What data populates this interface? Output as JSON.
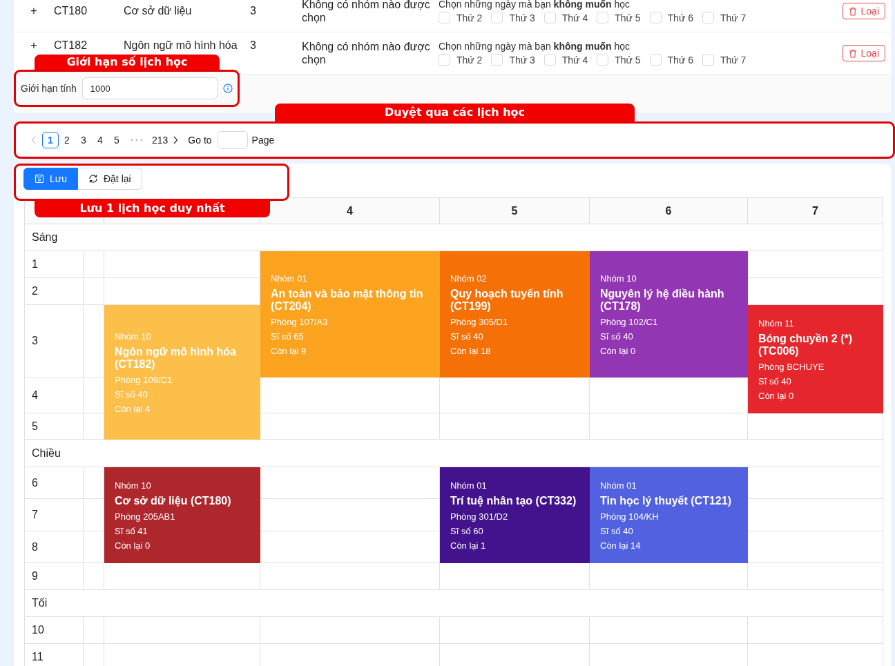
{
  "course_rows": [
    {
      "expand": "+",
      "code": "CT180",
      "name": "Cơ sở dữ liệu",
      "credits": "3",
      "status": "Không có nhóm nào được chọn",
      "prompt": "Chọn những ngày mà bạn **không muốn** học",
      "days": [
        {
          "label": "Thứ 2",
          "checked": false
        },
        {
          "label": "Thứ 3",
          "checked": false
        },
        {
          "label": "Thứ 4",
          "checked": false
        },
        {
          "label": "Thứ 5",
          "checked": false
        },
        {
          "label": "Thứ 6",
          "checked": false
        },
        {
          "label": "Thứ 7",
          "checked": false
        }
      ],
      "remove": "Loại"
    },
    {
      "expand": "+",
      "code": "CT182",
      "name": "Ngôn ngữ mô hình hóa",
      "credits": "3",
      "status": "Không có nhóm nào được chọn",
      "prompt": "Chọn những ngày mà bạn **không muốn** học",
      "days": [
        {
          "label": "Thứ 2",
          "checked": false
        },
        {
          "label": "Thứ 3",
          "checked": false
        },
        {
          "label": "Thứ 4",
          "checked": false
        },
        {
          "label": "Thứ 5",
          "checked": false
        },
        {
          "label": "Thứ 6",
          "checked": false
        },
        {
          "label": "Thứ 7",
          "checked": false
        }
      ],
      "remove": "Loại"
    }
  ],
  "limit": {
    "annotation": "Giới hạn số lịch học",
    "label": "Giới hạn tính",
    "value": "1000"
  },
  "pagination": {
    "annotation": "Duyệt qua các lịch học",
    "prev_disabled": true,
    "next_disabled": false,
    "pages": [
      {
        "kind": "page",
        "label": "1",
        "selected": true
      },
      {
        "kind": "page",
        "label": "2",
        "selected": false
      },
      {
        "kind": "page",
        "label": "3",
        "selected": false
      },
      {
        "kind": "page",
        "label": "4",
        "selected": false
      },
      {
        "kind": "page",
        "label": "5",
        "selected": false
      },
      {
        "kind": "ellipsis"
      },
      {
        "kind": "page",
        "label": "213",
        "selected": false
      }
    ],
    "goto_label": "Go to",
    "page_label": "Page"
  },
  "actions": {
    "annotation": "Lưu 1 lịch học duy nhất",
    "buttons": [
      {
        "label": "Lưu",
        "kind": "primary"
      },
      {
        "label": "Đặt lại",
        "kind": "default"
      }
    ]
  },
  "timetable": {
    "days": [
      {
        "label": "4"
      },
      {
        "label": "5"
      },
      {
        "label": "6"
      },
      {
        "label": "7"
      }
    ],
    "rows": [
      {
        "kind": "section",
        "label": "Sáng"
      },
      {
        "kind": "period",
        "label": "1",
        "cells": [
          {
            "kind": "empty"
          },
          {
            "kind": "empty"
          },
          {
            "kind": "class",
            "group": "Nhóm 01",
            "title": "An toàn và bảo mật thông tin (CT204)",
            "room": "Phòng 107/A3",
            "size": "Sĩ số 65",
            "remaining": "Còn lại 9",
            "color": "#fca320"
          },
          {
            "kind": "class",
            "group": "Nhóm 02",
            "title": "Quy hoạch tuyến tính (CT199)",
            "room": "Phòng 305/D1",
            "size": "Sĩ số 40",
            "remaining": "Còn lại 18",
            "color": "#f57107"
          },
          {
            "kind": "class",
            "group": "Nhóm 10",
            "title": "Nguyên lý hệ điều hành (CT178)",
            "room": "Phòng 102/C1",
            "size": "Sĩ số 40",
            "remaining": "Còn lại 0",
            "color": "#9236b4"
          },
          {
            "kind": "empty"
          }
        ]
      },
      {
        "kind": "period",
        "label": "2",
        "cells": [
          {
            "kind": "empty"
          },
          {
            "kind": "empty"
          },
          {
            "kind": "covered"
          },
          {
            "kind": "covered"
          },
          {
            "kind": "covered"
          },
          {
            "kind": "empty"
          }
        ]
      },
      {
        "kind": "period",
        "label": "3",
        "cells": [
          {
            "kind": "empty"
          },
          {
            "kind": "class",
            "group": "Nhóm 10",
            "title": "Ngôn ngữ mô hình hóa (CT182)",
            "room": "Phòng 109/C1",
            "size": "Sĩ số 40",
            "remaining": "Còn lại 4",
            "color": "#fcbf49"
          },
          {
            "kind": "covered"
          },
          {
            "kind": "covered"
          },
          {
            "kind": "covered"
          },
          {
            "kind": "class",
            "group": "Nhóm 11",
            "title": "Bóng chuyền 2 (*) (TC006)",
            "room": "Phòng BCHUYE",
            "size": "Sĩ số 40",
            "remaining": "Còn lại 0",
            "color": "#e5272d"
          }
        ]
      },
      {
        "kind": "period",
        "label": "4",
        "cells": [
          {
            "kind": "empty"
          },
          {
            "kind": "covered"
          },
          {
            "kind": "empty"
          },
          {
            "kind": "empty"
          },
          {
            "kind": "empty"
          },
          {
            "kind": "covered"
          }
        ]
      },
      {
        "kind": "period",
        "label": "5",
        "cells": [
          {
            "kind": "empty"
          },
          {
            "kind": "covered"
          },
          {
            "kind": "empty"
          },
          {
            "kind": "empty"
          },
          {
            "kind": "empty"
          },
          {
            "kind": "empty"
          }
        ]
      },
      {
        "kind": "section",
        "label": "Chiều"
      },
      {
        "kind": "period",
        "label": "6",
        "cells": [
          {
            "kind": "empty"
          },
          {
            "kind": "class",
            "group": "Nhóm 10",
            "title": "Cơ sở dữ liệu (CT180)",
            "room": "Phòng 205AB1",
            "size": "Sĩ số 41",
            "remaining": "Còn lại 0",
            "color": "#ad272d"
          },
          {
            "kind": "empty"
          },
          {
            "kind": "class",
            "group": "Nhóm 01",
            "title": "Trí tuệ nhân tạo (CT332)",
            "room": "Phòng 301/D2",
            "size": "Sĩ số 60",
            "remaining": "Còn lại 1",
            "color": "#42138c"
          },
          {
            "kind": "class",
            "group": "Nhóm 01",
            "title": "Tin học lý thuyết (CT121)",
            "room": "Phòng 104/KH",
            "size": "Sĩ số 40",
            "remaining": "Còn lại 14",
            "color": "#5161e0"
          },
          {
            "kind": "empty"
          }
        ]
      },
      {
        "kind": "period",
        "label": "7",
        "cells": [
          {
            "kind": "empty"
          },
          {
            "kind": "covered"
          },
          {
            "kind": "empty"
          },
          {
            "kind": "covered"
          },
          {
            "kind": "covered"
          },
          {
            "kind": "empty"
          }
        ]
      },
      {
        "kind": "period",
        "label": "8",
        "cells": [
          {
            "kind": "empty"
          },
          {
            "kind": "covered"
          },
          {
            "kind": "empty"
          },
          {
            "kind": "covered"
          },
          {
            "kind": "covered"
          },
          {
            "kind": "empty"
          }
        ]
      },
      {
        "kind": "period",
        "label": "9",
        "cells": [
          {
            "kind": "empty"
          },
          {
            "kind": "empty"
          },
          {
            "kind": "empty"
          },
          {
            "kind": "empty"
          },
          {
            "kind": "empty"
          },
          {
            "kind": "empty"
          }
        ]
      },
      {
        "kind": "section",
        "label": "Tối"
      },
      {
        "kind": "period",
        "label": "10",
        "cells": [
          {
            "kind": "empty"
          },
          {
            "kind": "empty"
          },
          {
            "kind": "empty"
          },
          {
            "kind": "empty"
          },
          {
            "kind": "empty"
          },
          {
            "kind": "empty"
          }
        ]
      },
      {
        "kind": "period",
        "label": "11",
        "cells": [
          {
            "kind": "empty"
          },
          {
            "kind": "empty"
          },
          {
            "kind": "empty"
          },
          {
            "kind": "empty"
          },
          {
            "kind": "empty"
          },
          {
            "kind": "empty"
          }
        ]
      }
    ]
  }
}
